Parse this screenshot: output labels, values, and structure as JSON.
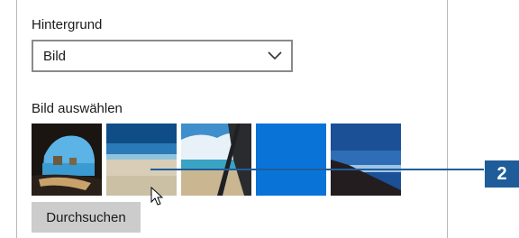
{
  "background_section": {
    "label": "Hintergrund",
    "dropdown_value": "Bild"
  },
  "picture_section": {
    "label": "Bild auswählen",
    "thumbnails": [
      {
        "name": "cave-beach"
      },
      {
        "name": "sandy-beach"
      },
      {
        "name": "beach-through-window"
      },
      {
        "name": "solid-blue"
      },
      {
        "name": "hillside-sky"
      }
    ],
    "accent_color": "#0a73d7"
  },
  "browse_button": {
    "label": "Durchsuchen"
  },
  "callout": {
    "number": "2",
    "color": "#1f5d9a"
  },
  "icons": [
    "chevron-down-icon",
    "mouse-cursor-icon"
  ]
}
